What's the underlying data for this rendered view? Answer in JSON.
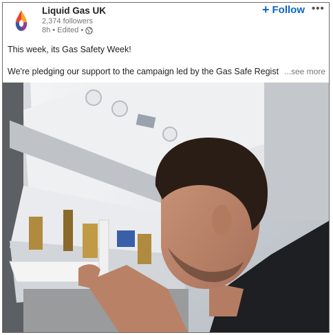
{
  "post": {
    "company_name": "Liquid Gas UK",
    "followers": "2,374 followers",
    "time": "8h",
    "edited": "Edited",
    "follow_label": "Follow",
    "follow_plus": "+",
    "menu": "•••",
    "line1": "This week, its Gas Safety Week!",
    "line2": "We're pledging our support to the campaign led by the Gas Safe Regist",
    "see_more": "...see more"
  },
  "icons": {
    "logo": "flame-logo-icon",
    "globe": "globe-icon",
    "menu": "more-options-icon"
  },
  "colors": {
    "follow": "#0a66c2",
    "meta": "#767676",
    "text": "#1f1f1f"
  }
}
